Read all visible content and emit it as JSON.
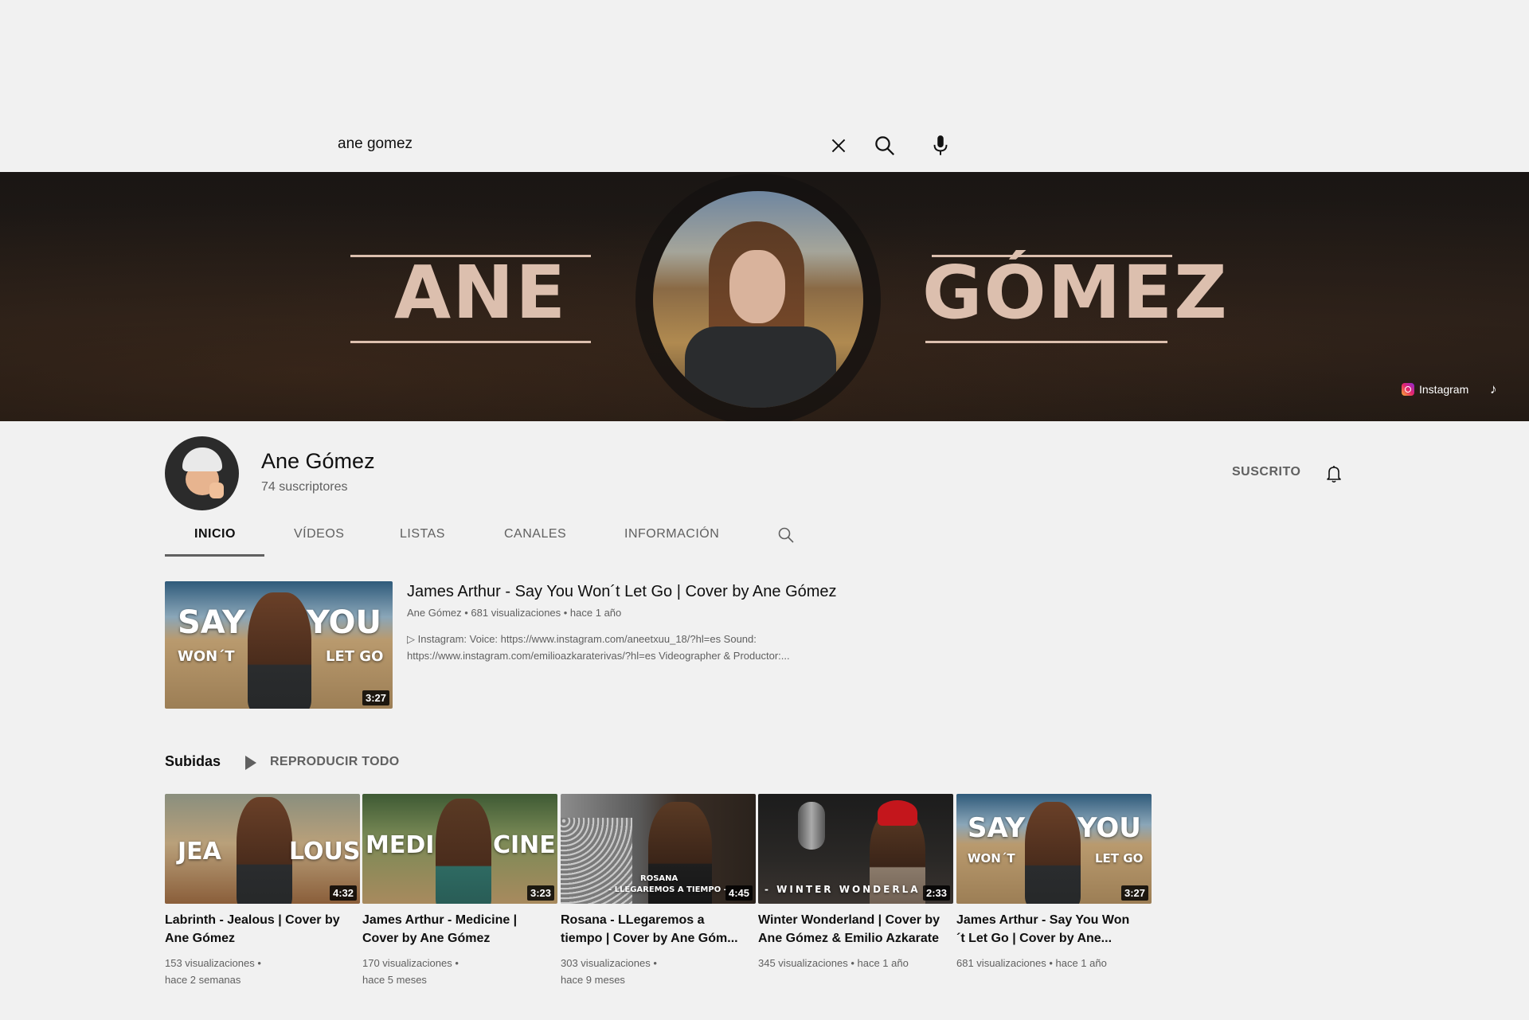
{
  "search": {
    "query": "ane gomez"
  },
  "banner": {
    "word_left": "ANE",
    "word_right": "GÓMEZ",
    "link_instagram": "Instagram",
    "link_tiktok_icon": "♪"
  },
  "channel": {
    "name": "Ane Gómez",
    "subscribers": "74 suscriptores",
    "subscribed_label": "SUSCRITO"
  },
  "tabs": [
    {
      "label": "INICIO",
      "active": true
    },
    {
      "label": "VÍDEOS"
    },
    {
      "label": "LISTAS"
    },
    {
      "label": "CANALES"
    },
    {
      "label": "INFORMACIÓN"
    }
  ],
  "featured": {
    "title": "James Arthur - Say You Won´t Let Go | Cover by Ane Gómez",
    "meta": "Ane Gómez • 681 visualizaciones • hace 1 año",
    "desc_line1": "▷ Instagram: Voice: https://www.instagram.com/aneetxuu_18/?hl=es Sound:",
    "desc_line2": "https://www.instagram.com/emilioazkaraterivas/?hl=es Videographer & Productor:...",
    "duration": "3:27",
    "thumb_text_1": "SAY",
    "thumb_text_2": "YOU",
    "thumb_text_3": "WON´T",
    "thumb_text_4": "LET GO"
  },
  "uploads": {
    "title": "Subidas",
    "play_all": "REPRODUCIR TODO",
    "videos": [
      {
        "title_1": "Labrinth - Jealous | Cover by",
        "title_2": "Ane Gómez",
        "meta_1": "153 visualizaciones •",
        "meta_2": "hace 2 semanas",
        "duration": "4:32",
        "thumb_a": "JEA",
        "thumb_b": "LOUS"
      },
      {
        "title_1": "James Arthur - Medicine |",
        "title_2": "Cover by Ane Gómez",
        "meta_1": "170 visualizaciones •",
        "meta_2": "hace 5 meses",
        "duration": "3:23",
        "thumb_a": "MEDI",
        "thumb_b": "CINE"
      },
      {
        "title_1": "Rosana - LLegaremos a",
        "title_2": "tiempo | Cover by Ane Góm...",
        "meta_1": "303 visualizaciones •",
        "meta_2": "hace 9 meses",
        "duration": "4:45",
        "thumb_a": "ROSANA",
        "thumb_b": "- LLEGAREMOS A TIEMPO -"
      },
      {
        "title_1": "Winter Wonderland | Cover by",
        "title_2": "Ane Gómez & Emilio Azkarate",
        "meta_1": "345 visualizaciones • hace 1 año",
        "meta_2": "",
        "duration": "2:33",
        "thumb_a": "- WINTER WONDERLA",
        "thumb_b": ""
      },
      {
        "title_1": "James Arthur - Say You Won",
        "title_2": "´t Let Go | Cover by Ane...",
        "meta_1": "681 visualizaciones • hace 1 año",
        "meta_2": "",
        "duration": "3:27",
        "thumb_a": "SAY",
        "thumb_b": "YOU"
      }
    ]
  }
}
